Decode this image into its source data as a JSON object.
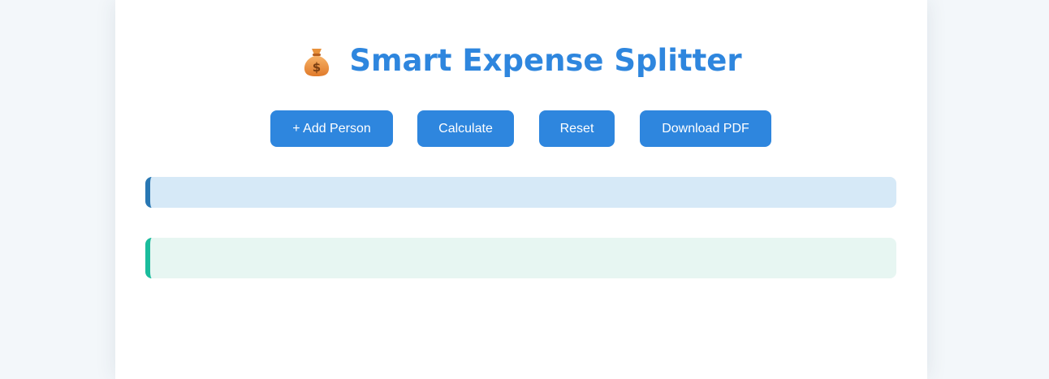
{
  "header": {
    "icon": "money-bag-icon",
    "title": "Smart Expense Splitter"
  },
  "toolbar": {
    "add_person_label": "+ Add Person",
    "calculate_label": "Calculate",
    "reset_label": "Reset",
    "download_pdf_label": "Download PDF"
  },
  "colors": {
    "accent": "#2e86de",
    "summary_panel_bg": "#d6e9f7",
    "summary_panel_border": "#2877b3",
    "settlement_panel_bg": "#e7f6f2",
    "settlement_panel_border": "#1abc9c",
    "page_bg": "#f3f7fa"
  }
}
